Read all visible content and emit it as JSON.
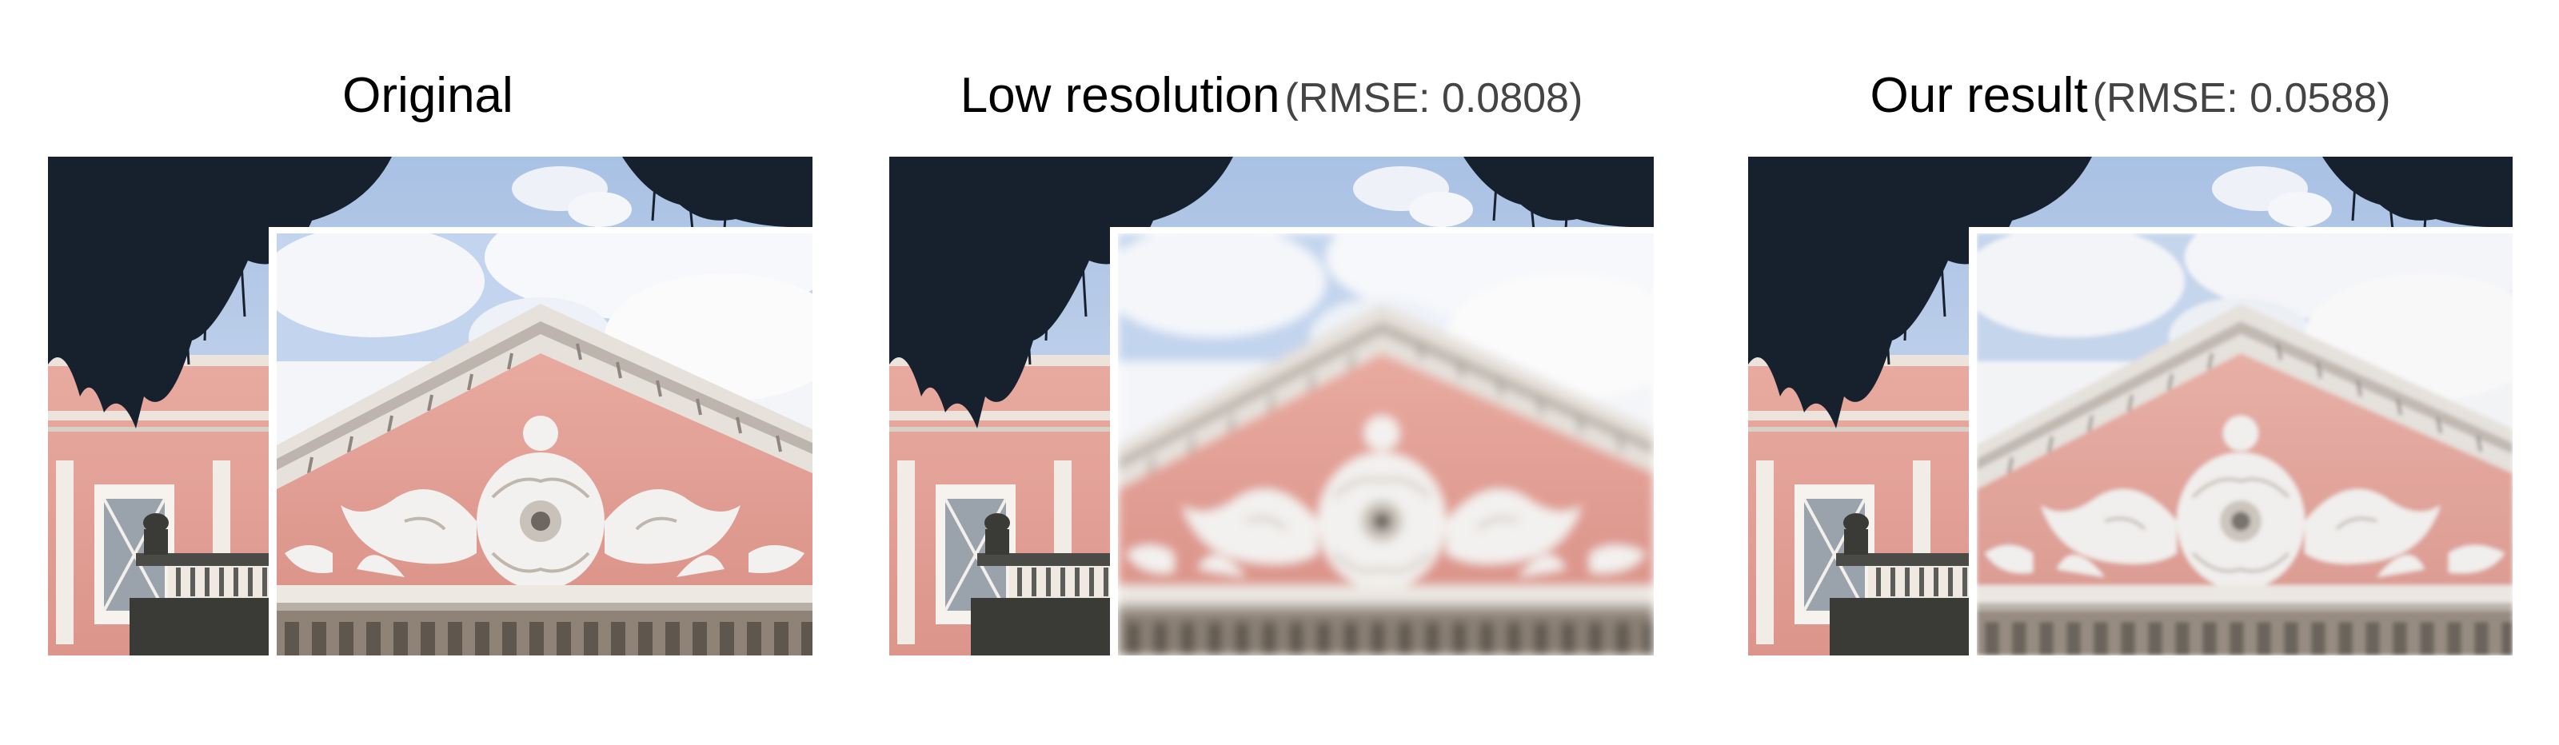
{
  "figure": {
    "panels": [
      {
        "id": "original",
        "title": "Original",
        "metric": "",
        "zoom_filter": "none"
      },
      {
        "id": "low-resolution",
        "title": "Low resolution",
        "metric": "(RMSE: 0.0808)",
        "zoom_filter": "blur-strong"
      },
      {
        "id": "our-result",
        "title": "Our result",
        "metric": "(RMSE: 0.0588)",
        "zoom_filter": "blur-light"
      }
    ],
    "colors": {
      "sky": "#bdd0ea",
      "cloud": "#f7f8fb",
      "building_pink": "#e3a198",
      "ornament_white": "#f3f1ef",
      "foliage": "#17212e",
      "stone_dark": "#3a3a36",
      "cornice_gray": "#d8d2cc"
    }
  }
}
